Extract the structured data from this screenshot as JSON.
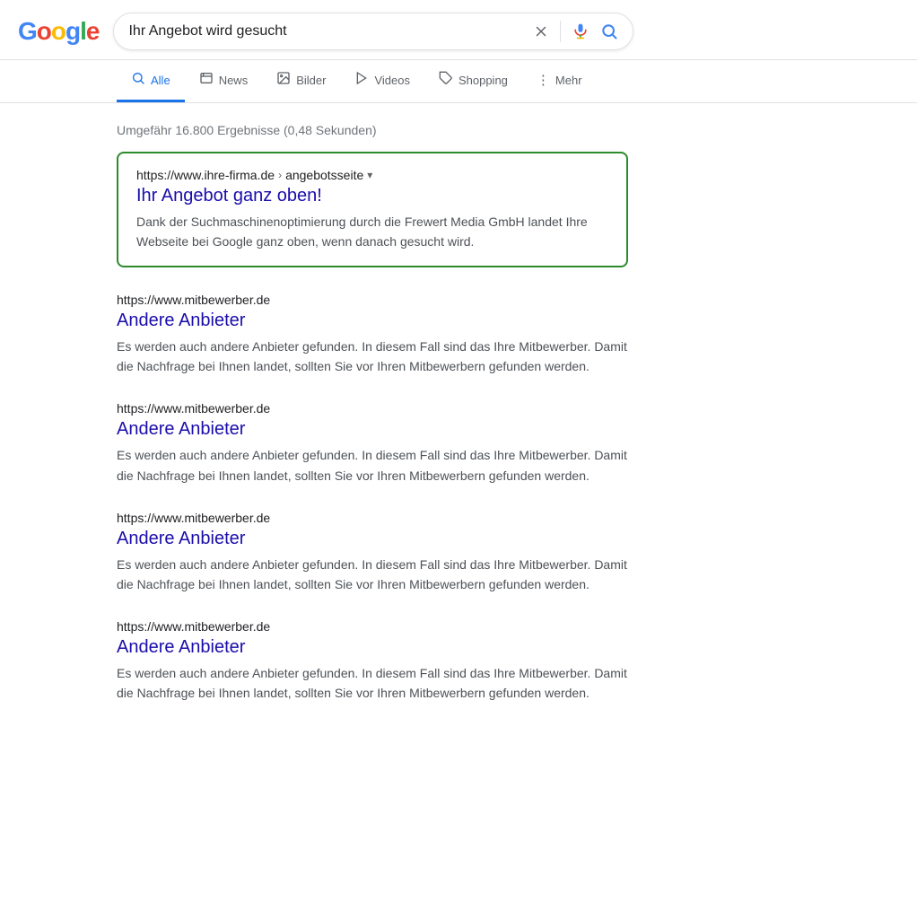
{
  "header": {
    "logo": {
      "g1": "G",
      "o1": "o",
      "o2": "o",
      "g2": "g",
      "l": "l",
      "e": "e"
    },
    "search": {
      "value": "Ihr Angebot wird gesucht",
      "clear_label": "×",
      "voice_label": "Spracheingabe",
      "search_label": "Suche"
    }
  },
  "nav": {
    "tabs": [
      {
        "id": "alle",
        "label": "Alle",
        "icon": "🔍",
        "active": true
      },
      {
        "id": "news",
        "label": "News",
        "icon": "📰",
        "active": false
      },
      {
        "id": "bilder",
        "label": "Bilder",
        "icon": "🖼",
        "active": false
      },
      {
        "id": "videos",
        "label": "Videos",
        "icon": "▶",
        "active": false
      },
      {
        "id": "shopping",
        "label": "Shopping",
        "icon": "🏷",
        "active": false
      },
      {
        "id": "mehr",
        "label": "Mehr",
        "icon": "⋮",
        "active": false
      }
    ]
  },
  "results": {
    "stats": "Umgefähr 16.800 Ergebnisse (0,48 Sekunden)",
    "featured": {
      "url": "https://www.ihre-firma.de",
      "url_path": "angebotsseite",
      "title": "Ihr Angebot ganz oben!",
      "snippet": "Dank der Suchmaschinenoptimierung durch die Frewert Media GmbH landet Ihre Webseite bei Google ganz oben, wenn danach gesucht wird."
    },
    "organic": [
      {
        "url": "https://www.mitbewerber.de",
        "title": "Andere Anbieter",
        "snippet": "Es werden auch andere Anbieter gefunden. In diesem Fall sind das Ihre Mitbewerber. Damit die Nachfrage bei Ihnen landet, sollten Sie vor Ihren Mitbewerbern gefunden werden."
      },
      {
        "url": "https://www.mitbewerber.de",
        "title": "Andere Anbieter",
        "snippet": "Es werden auch andere Anbieter gefunden. In diesem Fall sind das Ihre Mitbewerber. Damit die Nachfrage bei Ihnen landet, sollten Sie vor Ihren Mitbewerbern gefunden werden."
      },
      {
        "url": "https://www.mitbewerber.de",
        "title": "Andere Anbieter",
        "snippet": "Es werden auch andere Anbieter gefunden. In diesem Fall sind das Ihre Mitbewerber. Damit die Nachfrage bei Ihnen landet, sollten Sie vor Ihren Mitbewerbern gefunden werden."
      },
      {
        "url": "https://www.mitbewerber.de",
        "title": "Andere Anbieter",
        "snippet": "Es werden auch andere Anbieter gefunden. In diesem Fall sind das Ihre Mitbewerber. Damit die Nachfrage bei Ihnen landet, sollten Sie vor Ihren Mitbewerbern gefunden werden."
      }
    ]
  }
}
